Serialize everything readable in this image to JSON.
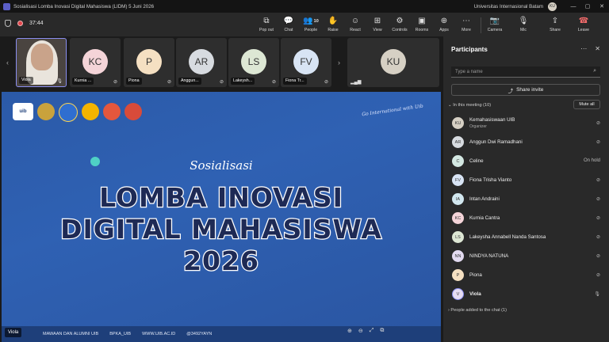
{
  "window": {
    "title": "Sosialisasi Lomba Inovasi Digital Mahasiswa (LIDM) 5 Juni 2026",
    "org": "Universitas Internasional Batam",
    "avatar": "KU",
    "controls": [
      "—",
      "▢",
      "✕"
    ]
  },
  "toolbar": {
    "timer": "37:44",
    "people_count": "10",
    "tools": [
      {
        "label": "Pop out",
        "icon": "pop-out-icon"
      },
      {
        "label": "Chat",
        "icon": "chat-icon"
      },
      {
        "label": "People",
        "icon": "people-icon"
      },
      {
        "label": "Raise",
        "icon": "hand-icon"
      },
      {
        "label": "React",
        "icon": "emoji-icon"
      },
      {
        "label": "View",
        "icon": "grid-icon"
      },
      {
        "label": "Controls",
        "icon": "controls-icon"
      },
      {
        "label": "Rooms",
        "icon": "rooms-icon"
      },
      {
        "label": "Apps",
        "icon": "apps-icon"
      },
      {
        "label": "More",
        "icon": "more-icon"
      }
    ],
    "camera": "Camera",
    "mic": "Mic",
    "share": "Share",
    "leave": "Leave"
  },
  "strip": {
    "tiles": [
      {
        "initials": "",
        "name": "Viola",
        "color": "#e9e4dc",
        "video": true
      },
      {
        "initials": "KC",
        "name": "Kurnia ...",
        "color": "#f4d4d8"
      },
      {
        "initials": "P",
        "name": "Piona",
        "color": "#f5e0c2"
      },
      {
        "initials": "AR",
        "name": "Anggun...",
        "color": "#d7dbe0"
      },
      {
        "initials": "LS",
        "name": "Lakeysh...",
        "color": "#dde7d4"
      },
      {
        "initials": "FV",
        "name": "Fiona Tr...",
        "color": "#d8e4f4"
      }
    ],
    "wide_tile": {
      "initials": "KU",
      "color": "#d6d0c4"
    }
  },
  "slide": {
    "logos": [
      "uib",
      "",
      "",
      "",
      "",
      ""
    ],
    "tagline": "Go International with Uib",
    "script_title": "Sosialisasi",
    "line1": "LOMBA INOVASI",
    "line2": "DIGITAL MAHASISWA",
    "line3": "2026",
    "footer": {
      "left": "MAWAAN DAN ALUMNI UIB",
      "instagram": "BPKA_UIB",
      "web": "WWW.UIB.AC.ID",
      "phone": "@3492YAYN"
    }
  },
  "stage_name": "Viola",
  "panel": {
    "title": "Participants",
    "search_placeholder": "Type a name",
    "share_invite": "Share invite",
    "section": "In this meeting (10)",
    "mute_all": "Mute all",
    "participants": [
      {
        "initials": "KU",
        "name": "Kemahasiswaan UIB",
        "role": "Organizer",
        "state": "mic-off",
        "color": "#d6d0c4"
      },
      {
        "initials": "AR",
        "name": "Anggun Dwi Ramadhani",
        "role": "",
        "state": "mic-off",
        "color": "#d7dbe0"
      },
      {
        "initials": "C",
        "name": "Celine",
        "role": "",
        "state": "On hold",
        "color": "#d4e8e2"
      },
      {
        "initials": "FV",
        "name": "Fiona Trisha Vianto",
        "role": "",
        "state": "mic-off",
        "color": "#d8e4f4"
      },
      {
        "initials": "IA",
        "name": "Intan Andraini",
        "role": "",
        "state": "mic-off",
        "color": "#d2e7ef"
      },
      {
        "initials": "KC",
        "name": "Kurnia Cantra",
        "role": "",
        "state": "mic-off",
        "color": "#f4d4d8"
      },
      {
        "initials": "LS",
        "name": "Lakeysha Annabell Nanda Santosa",
        "role": "",
        "state": "mic-off",
        "color": "#dde7d4"
      },
      {
        "initials": "NN",
        "name": "NINDYA NATUNA",
        "role": "",
        "state": "mic-off",
        "color": "#e2daf0"
      },
      {
        "initials": "P",
        "name": "Piona",
        "role": "",
        "state": "mic-off",
        "color": "#f5e0c2"
      },
      {
        "initials": "V",
        "name": "Viola",
        "role": "",
        "state": "mic-on",
        "color": "#e6dcf2"
      }
    ],
    "added": "People added to the chat (1)"
  }
}
